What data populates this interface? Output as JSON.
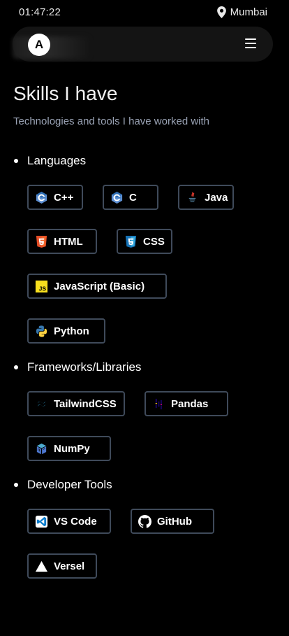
{
  "status": {
    "time": "01:47:22",
    "location": "Mumbai"
  },
  "nav": {
    "logo_letter": "A"
  },
  "page": {
    "title": "Skills I have",
    "subtitle": "Technologies and tools I have worked with"
  },
  "sections": [
    {
      "title": "Languages",
      "items": [
        {
          "label": "C++",
          "icon": "cpp-icon",
          "color": "#2f6fb5"
        },
        {
          "label": "C",
          "icon": "c-icon",
          "color": "#2f6fb5"
        },
        {
          "label": "Java",
          "icon": "java-icon",
          "color": "#e23b2e"
        },
        {
          "label": "HTML",
          "icon": "html5-icon",
          "color": "#e44d26"
        },
        {
          "label": "CSS",
          "icon": "css3-icon",
          "color": "#2965f1"
        },
        {
          "label": "JavaScript (Basic)",
          "icon": "javascript-icon",
          "color": "#f7df1e"
        },
        {
          "label": "Python",
          "icon": "python-icon",
          "color": "#3776ab"
        }
      ]
    },
    {
      "title": "Frameworks/Libraries",
      "items": [
        {
          "label": "TailwindCSS",
          "icon": "tailwindcss-icon",
          "color": "#38bdf8"
        },
        {
          "label": "Pandas",
          "icon": "pandas-icon",
          "color": "#150458"
        },
        {
          "label": "NumPy",
          "icon": "numpy-icon",
          "color": "#4d77cf"
        }
      ]
    },
    {
      "title": "Developer Tools",
      "items": [
        {
          "label": "VS Code",
          "icon": "vscode-icon",
          "color": "#007acc"
        },
        {
          "label": "GitHub",
          "icon": "github-icon",
          "color": "#ffffff"
        },
        {
          "label": "Versel",
          "icon": "vercel-icon",
          "color": "#ffffff"
        }
      ]
    }
  ]
}
